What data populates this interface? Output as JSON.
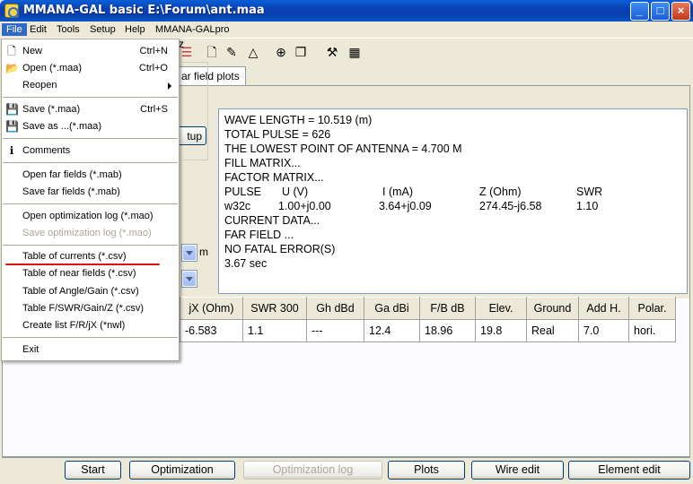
{
  "window": {
    "title": "MMANA-GAL basic E:\\Forum\\ant.maa"
  },
  "menubar": {
    "items": [
      "File",
      "Edit",
      "Tools",
      "Setup",
      "Help",
      "MMANA-GALpro"
    ]
  },
  "tab": {
    "label": "ar field plots"
  },
  "freq_label": "z",
  "setup_label": "tup",
  "units_label": "m",
  "output": {
    "lines": [
      "WAVE LENGTH = 10.519 (m)",
      "TOTAL PULSE = 626",
      "THE LOWEST POINT OF ANTENNA = 4.700 M",
      "FILL MATRIX...",
      "FACTOR MATRIX...",
      "CURRENT DATA...",
      "FAR FIELD ...",
      "NO FATAL ERROR(S)",
      "3.67 sec"
    ],
    "pulse_header": [
      "PULSE",
      "U (V)",
      "I (mA)",
      "Z (Ohm)",
      "SWR"
    ],
    "pulse_row": [
      "w32c",
      "1.00+j0.00",
      "3.64+j0.09",
      "274.45-j6.58",
      "1.10"
    ]
  },
  "results": {
    "headers": [
      "jX (Ohm)",
      "SWR 300",
      "Gh dBd",
      "Ga dBi",
      "F/B dB",
      "Elev.",
      "Ground",
      "Add H.",
      "Polar."
    ],
    "row": [
      "-6.583",
      "1.1",
      "---",
      "12.4",
      "18.96",
      "19.8",
      "Real",
      "7.0",
      "hori."
    ]
  },
  "buttons": {
    "start": "Start",
    "optimization": "Optimization",
    "optimization_log": "Optimization log",
    "plots": "Plots",
    "wire_edit": "Wire edit",
    "element_edit": "Element edit"
  },
  "file_menu": {
    "new": {
      "label": "New",
      "shortcut": "Ctrl+N"
    },
    "open": {
      "label": "Open (*.maa)",
      "shortcut": "Ctrl+O"
    },
    "reopen": {
      "label": "Reopen"
    },
    "save": {
      "label": "Save (*.maa)",
      "shortcut": "Ctrl+S"
    },
    "save_as": {
      "label": "Save as ...(*.maa)"
    },
    "comments": {
      "label": "Comments"
    },
    "open_far": {
      "label": "Open far fields (*.mab)"
    },
    "save_far": {
      "label": "Save far fields (*.mab)"
    },
    "open_opt_log": {
      "label": "Open optimization log (*.mao)"
    },
    "save_opt_log": {
      "label": "Save optimization log (*.mao)"
    },
    "table_currents": {
      "label": "Table of currents (*.csv)"
    },
    "table_near": {
      "label": "Table of near fields (*.csv)"
    },
    "table_angle": {
      "label": "Table of Angle/Gain (*.csv)"
    },
    "table_fswr": {
      "label": "Table F/SWR/Gain/Z (*.csv)"
    },
    "create_list": {
      "label": "Create list F/R/jX (*nwl)"
    },
    "exit": {
      "label": "Exit"
    }
  }
}
